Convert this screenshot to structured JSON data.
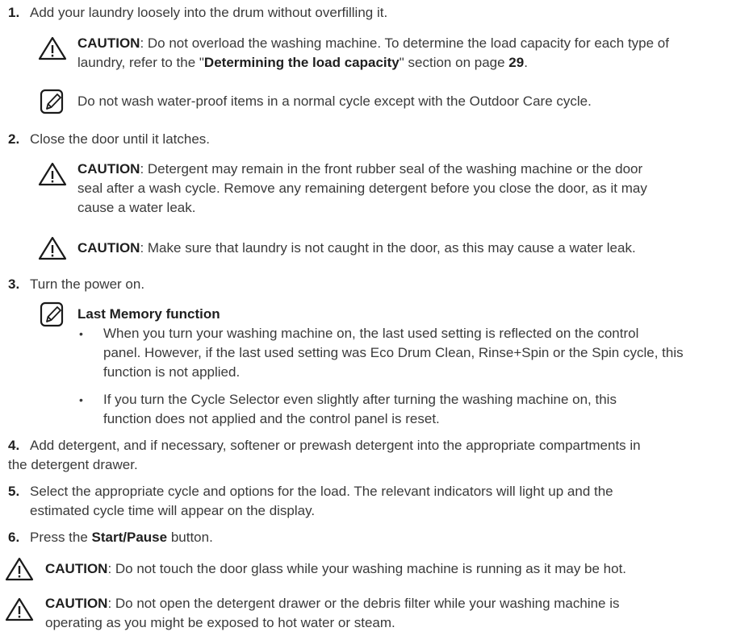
{
  "steps": [
    {
      "num": "1.",
      "text": "Add your laundry loosely into the drum without overfilling it."
    },
    {
      "num": "2.",
      "text": "Close the door until it latches."
    },
    {
      "num": "3.",
      "text": "Turn the power on."
    },
    {
      "num": "4.",
      "text_line1": "Add detergent, and if necessary, softener or prewash detergent into the appropriate compartments in",
      "text_line2": "the detergent drawer."
    },
    {
      "num": "5.",
      "text_line1": "Select the appropriate cycle and options for the load. The relevant indicators will light up and the",
      "text_line2": "estimated cycle time will appear on the display."
    },
    {
      "num": "6.",
      "pre": "Press the ",
      "bold": "Start/Pause",
      "post": " button."
    }
  ],
  "caution_label": "CAUTION",
  "caution_1": {
    "line1": ": Do not overload the washing machine. To determine the load capacity for each type of",
    "line2_pre": "laundry, refer to the \"",
    "line2_bold": "Determining the load capacity",
    "line2_mid": "\" section on page ",
    "line2_page": "29",
    "line2_post": "."
  },
  "note_1": "Do not wash water-proof items in a normal cycle except with the Outdoor Care cycle.",
  "caution_2": {
    "line1": ": Detergent may remain in the front rubber seal of the washing machine or the door",
    "line2": "seal after a wash cycle. Remove any remaining detergent before you close the door, as it may",
    "line3": "cause a water leak."
  },
  "caution_3": ": Make sure that laundry is not caught in the door, as this may cause a water leak.",
  "note_2": {
    "title": "Last Memory function",
    "bullet_1_line1": "When you turn your washing machine on, the last used setting is reflected on the control",
    "bullet_1_line2": "panel. However, if the last used setting was Eco Drum Clean, Rinse+Spin or the Spin cycle, this",
    "bullet_1_line3": "function is not applied.",
    "bullet_2_line1": "If you turn the Cycle Selector even slightly after turning the washing machine on, this",
    "bullet_2_line2": "function does not applied and the control panel is reset."
  },
  "caution_4": ": Do not touch the door glass while your washing machine is running as it may be hot.",
  "caution_5": {
    "line1": ": Do not open the detergent drawer or the debris filter while your washing machine is",
    "line2": "operating as you might be exposed to hot water or steam."
  },
  "bullet_char": "•",
  "icons": {
    "caution": "warning-triangle-icon",
    "note": "note-pencil-icon"
  }
}
